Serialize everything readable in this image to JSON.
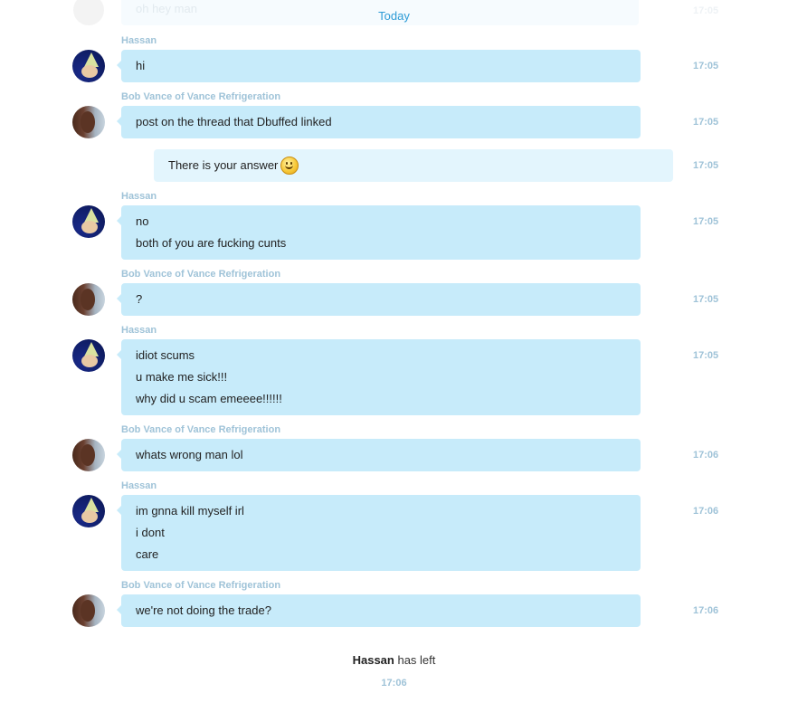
{
  "conversation": {
    "faded_message": "oh hey man",
    "faded_time": "17:05",
    "day_divider": "Today",
    "messages": [
      {
        "sender": "Hassan",
        "lines": [
          "hi"
        ],
        "time": "17:05"
      },
      {
        "sender": "Bob Vance of Vance Refrigeration",
        "lines": [
          "post on the thread that Dbuffed linked"
        ],
        "time": "17:05"
      },
      {
        "sender": "",
        "lines": [
          "There is your answer"
        ],
        "time": "17:05"
      },
      {
        "sender": "Hassan",
        "lines": [
          "no",
          "both of you are fucking cunts"
        ],
        "time": "17:05"
      },
      {
        "sender": "Bob Vance of Vance Refrigeration",
        "lines": [
          "?"
        ],
        "time": "17:05"
      },
      {
        "sender": "Hassan",
        "lines": [
          "idiot scums",
          "u make me sick!!!",
          "why did u scam emeeee!!!!!!"
        ],
        "time": "17:05"
      },
      {
        "sender": "Bob Vance of Vance Refrigeration",
        "lines": [
          "whats wrong man lol"
        ],
        "time": "17:06"
      },
      {
        "sender": "Hassan",
        "lines": [
          "im gnna kill myself irl",
          "i dont",
          "care"
        ],
        "time": "17:06"
      },
      {
        "sender": "Bob Vance of Vance Refrigeration",
        "lines": [
          "we're not doing the trade?"
        ],
        "time": "17:06"
      }
    ],
    "system_event": {
      "user": "Hassan",
      "text": "has left",
      "time": "17:06"
    }
  },
  "icons": {
    "emoticon": "smiley-icon"
  }
}
